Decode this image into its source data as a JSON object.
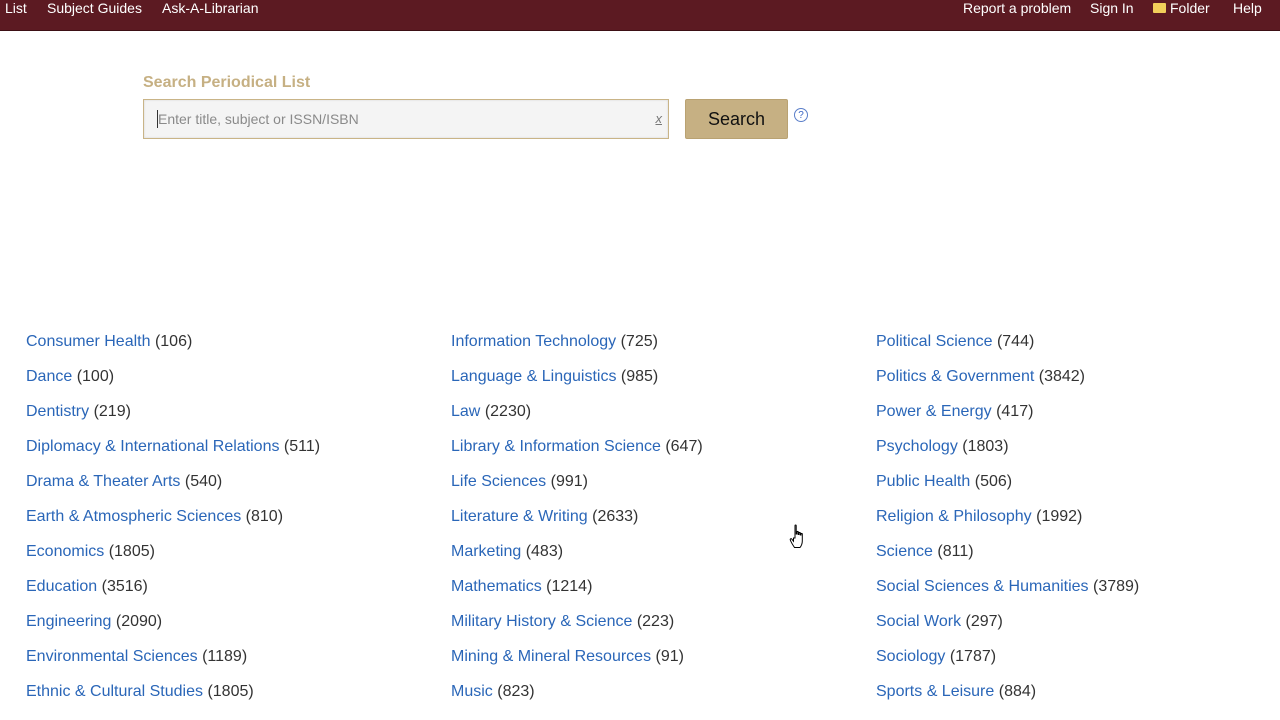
{
  "topnav": {
    "left": [
      "List",
      "Subject Guides",
      "Ask-A-Librarian"
    ],
    "right": [
      "Report a problem",
      "Sign In",
      "Folder",
      "Help"
    ]
  },
  "search": {
    "label": "Search Periodical List",
    "placeholder": "Enter title, subject or ISSN/ISBN",
    "value": "",
    "clear_symbol": "x",
    "button_label": "Search",
    "help_symbol": "?"
  },
  "subjects": {
    "col1": [
      {
        "name": "Consumer Health",
        "count": "(106)"
      },
      {
        "name": "Dance",
        "count": "(100)"
      },
      {
        "name": "Dentistry",
        "count": "(219)"
      },
      {
        "name": "Diplomacy & International Relations",
        "count": "(511)"
      },
      {
        "name": "Drama & Theater Arts",
        "count": "(540)"
      },
      {
        "name": "Earth & Atmospheric Sciences",
        "count": "(810)"
      },
      {
        "name": "Economics",
        "count": "(1805)"
      },
      {
        "name": "Education",
        "count": "(3516)"
      },
      {
        "name": "Engineering",
        "count": "(2090)"
      },
      {
        "name": "Environmental Sciences",
        "count": "(1189)"
      },
      {
        "name": "Ethnic & Cultural Studies",
        "count": "(1805)"
      }
    ],
    "col2": [
      {
        "name": "Information Technology",
        "count": "(725)"
      },
      {
        "name": "Language & Linguistics",
        "count": "(985)"
      },
      {
        "name": "Law",
        "count": "(2230)"
      },
      {
        "name": "Library & Information Science",
        "count": "(647)"
      },
      {
        "name": "Life Sciences",
        "count": "(991)"
      },
      {
        "name": "Literature & Writing",
        "count": "(2633)"
      },
      {
        "name": "Marketing",
        "count": "(483)"
      },
      {
        "name": "Mathematics",
        "count": "(1214)"
      },
      {
        "name": "Military History & Science",
        "count": "(223)"
      },
      {
        "name": "Mining & Mineral Resources",
        "count": "(91)"
      },
      {
        "name": "Music",
        "count": "(823)"
      }
    ],
    "col3": [
      {
        "name": "Political Science",
        "count": "(744)"
      },
      {
        "name": "Politics & Government",
        "count": "(3842)"
      },
      {
        "name": "Power & Energy",
        "count": "(417)"
      },
      {
        "name": "Psychology",
        "count": "(1803)"
      },
      {
        "name": "Public Health",
        "count": "(506)"
      },
      {
        "name": "Religion & Philosophy",
        "count": "(1992)"
      },
      {
        "name": "Science",
        "count": "(811)"
      },
      {
        "name": "Social Sciences & Humanities",
        "count": "(3789)"
      },
      {
        "name": "Social Work",
        "count": "(297)"
      },
      {
        "name": "Sociology",
        "count": "(1787)"
      },
      {
        "name": "Sports & Leisure",
        "count": "(884)"
      }
    ]
  },
  "colors": {
    "topbar": "#5c1a22",
    "accent": "#c6b083",
    "link": "#2a66b8"
  },
  "icons": {
    "folder": "folder-icon",
    "help": "help-icon",
    "clear": "clear-icon",
    "cursor": "hand-cursor-icon"
  }
}
